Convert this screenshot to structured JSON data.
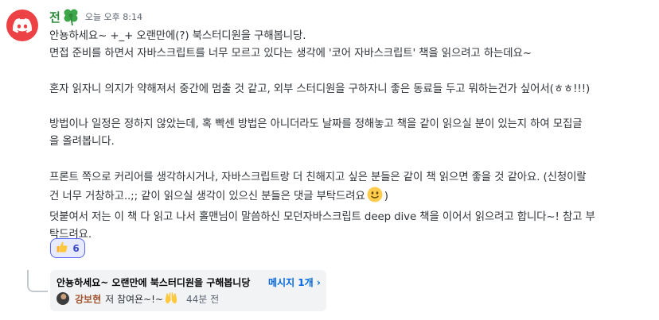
{
  "message": {
    "author": "전",
    "author_emoji": "four-leaf-clover-icon",
    "timestamp": "오늘 오후 8:14",
    "lines": [
      "안뇽하세요~ +_+ 오랜만에(?) 북스터디원을 구해봅니당.",
      "면접 준비를 하면서 자바스크립트를 너무 모르고 있다는 생각에 '코어 자바스크립트' 책을 읽으려고 하는데요~",
      "",
      "혼자 읽자니 의지가 약해져서 중간에 멈출 것 같고, 외부 스터디원을 구하자니 좋은 동료들 두고 뭐하는건가 싶어서(ㅎㅎ!!!)",
      "",
      "방법이나 일정은 정하지 않았는데, 혹 빡센 방법은 아니더라도 날짜를 정해놓고 책을 같이 읽으실 분이 있는지 하여 모집글",
      "을 올려봅니다.",
      "",
      "프론트 쪽으로 커리어를 생각하시거나, 자바스크립트랑 더 친해지고 싶은 분들은 같이 책 읽으면 좋을 것 같아요. (신청이랄",
      "건 너무 거창하고..;; 같이 읽으실 생각이 있으신 분들은 댓글 부탁드려요",
      "덧붙여서 저는 이 책 다 읽고 나서 홀맨님이 말씀하신 모던자바스크립트 deep dive 책을 이어서 읽으려고 합니다~! 참고 부",
      "탁드려요."
    ],
    "line10_suffix": ")",
    "inline_emoji": "smiling-face-icon"
  },
  "reaction": {
    "emoji": "thumbs-up-icon",
    "count": "6"
  },
  "thread": {
    "title": "안뇽하세요~ 오랜만에 북스터디원을 구해봅니당",
    "count_label": "메시지 1개 ›",
    "last_author": "강보현",
    "last_message": "저 참여욘~!~",
    "last_emoji": "raising-hands-icon",
    "last_time": "44분 전"
  },
  "colors": {
    "avatar_bg": "#ed4245",
    "author": "#2d8c3c",
    "reaction_border": "#5865f2",
    "reaction_bg": "#e8ebff",
    "thread_count": "#0067e0",
    "thread_author": "#a0522d"
  }
}
